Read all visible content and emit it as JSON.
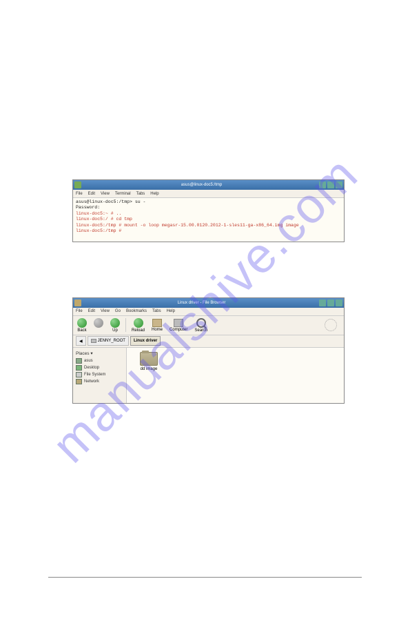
{
  "watermark": "manualshive.com",
  "terminal": {
    "title": "asus@linux-doc5:/tmp",
    "menu": [
      "File",
      "Edit",
      "View",
      "Terminal",
      "Tabs",
      "Help"
    ],
    "lines": [
      {
        "cls": "tline-black",
        "text": "asus@linux-doc5:/tmp> su -"
      },
      {
        "cls": "tline-black",
        "text": "Password:"
      },
      {
        "cls": "tline-red",
        "text": "linux-doc5:~ # .."
      },
      {
        "cls": "tline-red",
        "text": "linux-doc5:/ # cd tmp"
      },
      {
        "cls": "tline-red",
        "text": "linux-doc5:/tmp # mount -o loop megasr-15.00.0120.2012-1-sles11-ga-x86_64.img image"
      },
      {
        "cls": "tline-red",
        "text": "linux-doc5:/tmp # "
      }
    ]
  },
  "filebrowser": {
    "title": "Linux driver - File Browser",
    "menu": [
      "File",
      "Edit",
      "View",
      "Go",
      "Bookmarks",
      "Tabs",
      "Help"
    ],
    "toolbar": {
      "back": "Back",
      "up": "Up",
      "reload": "Reload",
      "home": "Home",
      "computer": "Computer",
      "search": "Search"
    },
    "path": {
      "root": "JENNY_ROOT",
      "current": "Linux driver"
    },
    "sidebar": {
      "header": "Places ▾",
      "items": [
        "asus",
        "Desktop",
        "File System",
        "Network"
      ]
    },
    "content": {
      "folder": "dd image"
    }
  }
}
